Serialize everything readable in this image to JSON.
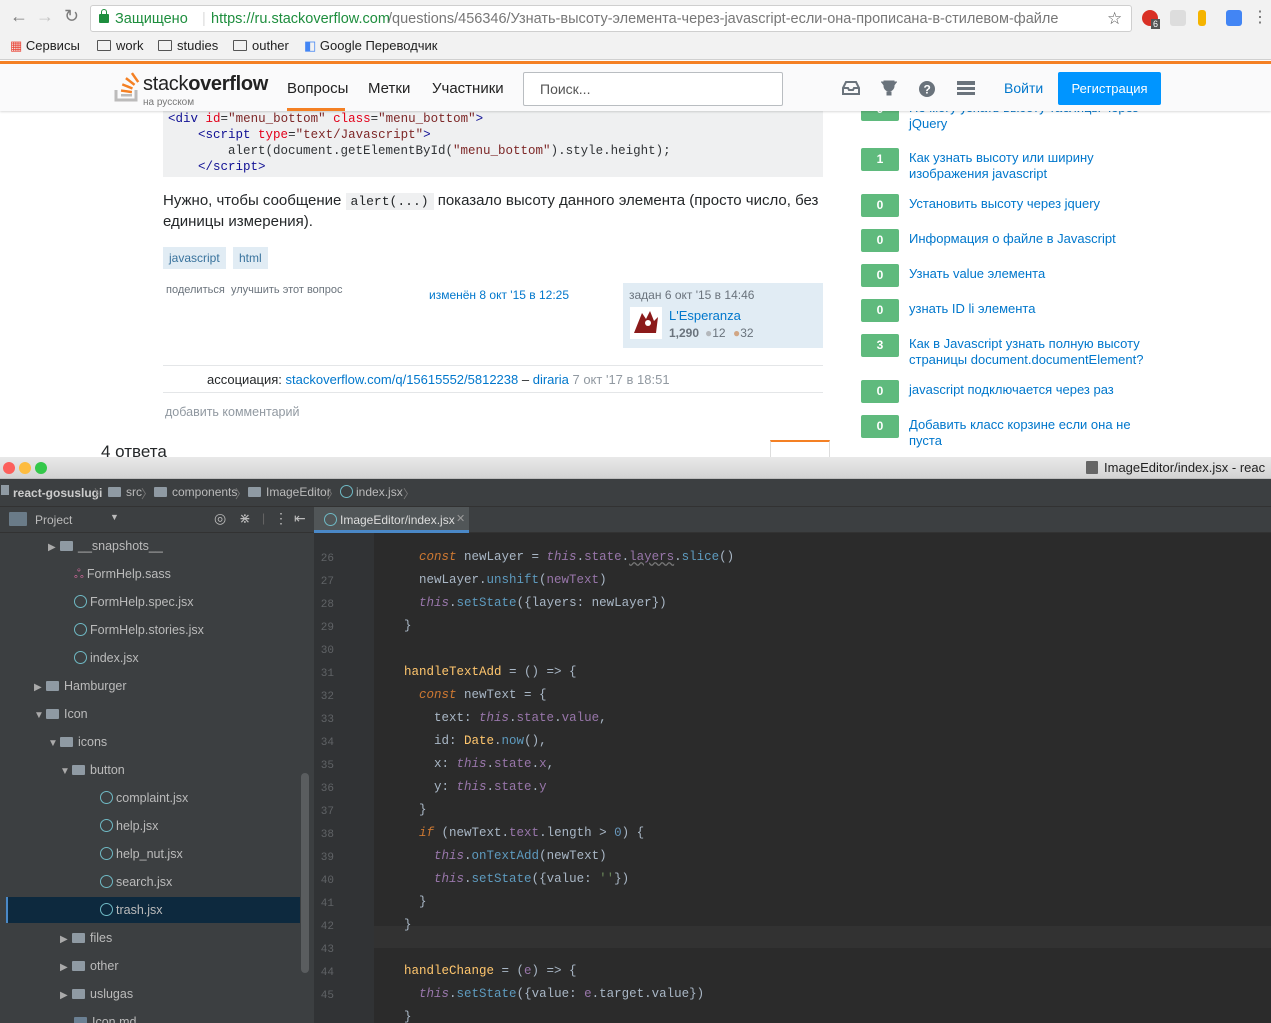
{
  "browser": {
    "secure_label": "Защищено",
    "url_host": "https://ru.stackoverflow.com",
    "url_path": "/questions/456346/Узнать-высоту-элемента-через-javascript-если-она-прописана-в-стилевом-файле",
    "ext_badge": "6",
    "bookmarks": [
      "Сервисы",
      "work",
      "studies",
      "outher",
      "Google Переводчик"
    ]
  },
  "so": {
    "logo_a": "stack",
    "logo_b": "overflow",
    "logo_sub": "на русском",
    "nav": [
      "Вопросы",
      "Метки",
      "Участники"
    ],
    "search_placeholder": "Поиск...",
    "login": "Войти",
    "register": "Регистрация"
  },
  "question": {
    "text": "Нужно, чтобы сообщение",
    "inline_code": "alert(...)",
    "text2": "показало высоту данного элемента (просто число, без единицы измерения).",
    "tags": [
      "javascript",
      "html"
    ],
    "share": "поделиться",
    "improve": "улучшить этот вопрос",
    "edited": "изменён 8 окт '15 в 12:25",
    "asked": "задан 6 окт '15 в 14:46",
    "user": "L'Esperanza",
    "rep": "1,290",
    "silver": "12",
    "bronze": "32",
    "assoc_label": "ассоциация:",
    "assoc_link": "stackoverflow.com/q/15615552/5812238",
    "assoc_dash": "–",
    "assoc_user": "diraria",
    "assoc_date": "7 окт '17 в 18:51",
    "add_comment": "добавить комментарий",
    "answers": "4 ответа"
  },
  "related": [
    {
      "score": "0",
      "title": "Не могу узнать высоту таблицы через jQuery"
    },
    {
      "score": "1",
      "title": "Как узнать высоту или ширину изображения javascript"
    },
    {
      "score": "0",
      "title": "Установить высоту через jquery"
    },
    {
      "score": "0",
      "title": "Информация о файле в Javascript"
    },
    {
      "score": "0",
      "title": "Узнать value элемента"
    },
    {
      "score": "0",
      "title": "узнать ID li элемента"
    },
    {
      "score": "3",
      "title": "Как в Javascript узнать полную высоту страницы document.documentElement?"
    },
    {
      "score": "0",
      "title": "javascript подключается через раз"
    },
    {
      "score": "0",
      "title": "Добавить класс корзине если она не пуста"
    }
  ],
  "ide": {
    "window_title": "ImageEditor/index.jsx - reac",
    "breadcrumb": [
      "react-gosuslugi",
      "src",
      "components",
      "ImageEditor",
      "index.jsx"
    ],
    "project_label": "Project",
    "tab": "ImageEditor/index.jsx",
    "tree": [
      "__snapshots__",
      "FormHelp.sass",
      "FormHelp.spec.jsx",
      "FormHelp.stories.jsx",
      "index.jsx",
      "Hamburger",
      "Icon",
      "icons",
      "button",
      "complaint.jsx",
      "help.jsx",
      "help_nut.jsx",
      "search.jsx",
      "trash.jsx",
      "files",
      "other",
      "uslugas",
      "Icon.md"
    ],
    "line_numbers": [
      "26",
      "27",
      "28",
      "29",
      "30",
      "31",
      "32",
      "33",
      "34",
      "35",
      "36",
      "37",
      "38",
      "39",
      "40",
      "41",
      "42",
      "43",
      "44",
      "45"
    ]
  },
  "colors": {
    "so_orange": "#f48024",
    "so_blue": "#0095ff",
    "score_green": "#5fba7d",
    "ide_bg": "#2b2b2b"
  }
}
